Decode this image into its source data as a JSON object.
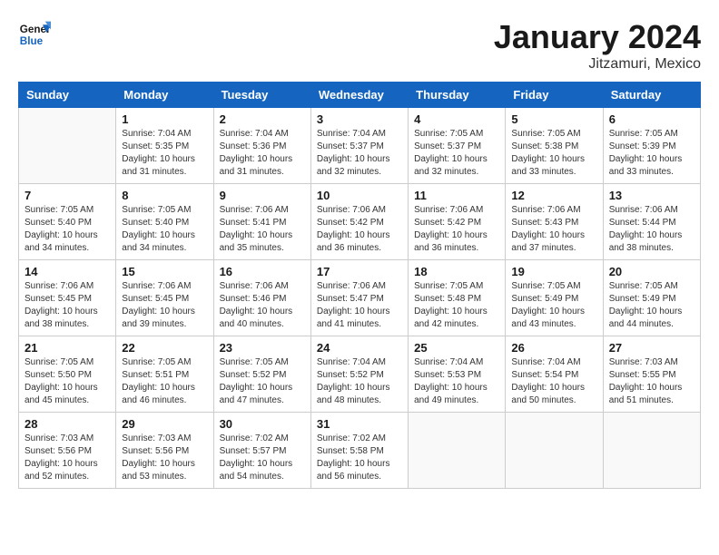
{
  "header": {
    "logo_text_general": "General",
    "logo_text_blue": "Blue",
    "title": "January 2024",
    "subtitle": "Jitzamuri, Mexico"
  },
  "weekdays": [
    "Sunday",
    "Monday",
    "Tuesday",
    "Wednesday",
    "Thursday",
    "Friday",
    "Saturday"
  ],
  "weeks": [
    [
      {
        "day": "",
        "info": ""
      },
      {
        "day": "1",
        "info": "Sunrise: 7:04 AM\nSunset: 5:35 PM\nDaylight: 10 hours\nand 31 minutes."
      },
      {
        "day": "2",
        "info": "Sunrise: 7:04 AM\nSunset: 5:36 PM\nDaylight: 10 hours\nand 31 minutes."
      },
      {
        "day": "3",
        "info": "Sunrise: 7:04 AM\nSunset: 5:37 PM\nDaylight: 10 hours\nand 32 minutes."
      },
      {
        "day": "4",
        "info": "Sunrise: 7:05 AM\nSunset: 5:37 PM\nDaylight: 10 hours\nand 32 minutes."
      },
      {
        "day": "5",
        "info": "Sunrise: 7:05 AM\nSunset: 5:38 PM\nDaylight: 10 hours\nand 33 minutes."
      },
      {
        "day": "6",
        "info": "Sunrise: 7:05 AM\nSunset: 5:39 PM\nDaylight: 10 hours\nand 33 minutes."
      }
    ],
    [
      {
        "day": "7",
        "info": "Sunrise: 7:05 AM\nSunset: 5:40 PM\nDaylight: 10 hours\nand 34 minutes."
      },
      {
        "day": "8",
        "info": "Sunrise: 7:05 AM\nSunset: 5:40 PM\nDaylight: 10 hours\nand 34 minutes."
      },
      {
        "day": "9",
        "info": "Sunrise: 7:06 AM\nSunset: 5:41 PM\nDaylight: 10 hours\nand 35 minutes."
      },
      {
        "day": "10",
        "info": "Sunrise: 7:06 AM\nSunset: 5:42 PM\nDaylight: 10 hours\nand 36 minutes."
      },
      {
        "day": "11",
        "info": "Sunrise: 7:06 AM\nSunset: 5:42 PM\nDaylight: 10 hours\nand 36 minutes."
      },
      {
        "day": "12",
        "info": "Sunrise: 7:06 AM\nSunset: 5:43 PM\nDaylight: 10 hours\nand 37 minutes."
      },
      {
        "day": "13",
        "info": "Sunrise: 7:06 AM\nSunset: 5:44 PM\nDaylight: 10 hours\nand 38 minutes."
      }
    ],
    [
      {
        "day": "14",
        "info": "Sunrise: 7:06 AM\nSunset: 5:45 PM\nDaylight: 10 hours\nand 38 minutes."
      },
      {
        "day": "15",
        "info": "Sunrise: 7:06 AM\nSunset: 5:45 PM\nDaylight: 10 hours\nand 39 minutes."
      },
      {
        "day": "16",
        "info": "Sunrise: 7:06 AM\nSunset: 5:46 PM\nDaylight: 10 hours\nand 40 minutes."
      },
      {
        "day": "17",
        "info": "Sunrise: 7:06 AM\nSunset: 5:47 PM\nDaylight: 10 hours\nand 41 minutes."
      },
      {
        "day": "18",
        "info": "Sunrise: 7:05 AM\nSunset: 5:48 PM\nDaylight: 10 hours\nand 42 minutes."
      },
      {
        "day": "19",
        "info": "Sunrise: 7:05 AM\nSunset: 5:49 PM\nDaylight: 10 hours\nand 43 minutes."
      },
      {
        "day": "20",
        "info": "Sunrise: 7:05 AM\nSunset: 5:49 PM\nDaylight: 10 hours\nand 44 minutes."
      }
    ],
    [
      {
        "day": "21",
        "info": "Sunrise: 7:05 AM\nSunset: 5:50 PM\nDaylight: 10 hours\nand 45 minutes."
      },
      {
        "day": "22",
        "info": "Sunrise: 7:05 AM\nSunset: 5:51 PM\nDaylight: 10 hours\nand 46 minutes."
      },
      {
        "day": "23",
        "info": "Sunrise: 7:05 AM\nSunset: 5:52 PM\nDaylight: 10 hours\nand 47 minutes."
      },
      {
        "day": "24",
        "info": "Sunrise: 7:04 AM\nSunset: 5:52 PM\nDaylight: 10 hours\nand 48 minutes."
      },
      {
        "day": "25",
        "info": "Sunrise: 7:04 AM\nSunset: 5:53 PM\nDaylight: 10 hours\nand 49 minutes."
      },
      {
        "day": "26",
        "info": "Sunrise: 7:04 AM\nSunset: 5:54 PM\nDaylight: 10 hours\nand 50 minutes."
      },
      {
        "day": "27",
        "info": "Sunrise: 7:03 AM\nSunset: 5:55 PM\nDaylight: 10 hours\nand 51 minutes."
      }
    ],
    [
      {
        "day": "28",
        "info": "Sunrise: 7:03 AM\nSunset: 5:56 PM\nDaylight: 10 hours\nand 52 minutes."
      },
      {
        "day": "29",
        "info": "Sunrise: 7:03 AM\nSunset: 5:56 PM\nDaylight: 10 hours\nand 53 minutes."
      },
      {
        "day": "30",
        "info": "Sunrise: 7:02 AM\nSunset: 5:57 PM\nDaylight: 10 hours\nand 54 minutes."
      },
      {
        "day": "31",
        "info": "Sunrise: 7:02 AM\nSunset: 5:58 PM\nDaylight: 10 hours\nand 56 minutes."
      },
      {
        "day": "",
        "info": ""
      },
      {
        "day": "",
        "info": ""
      },
      {
        "day": "",
        "info": ""
      }
    ]
  ]
}
